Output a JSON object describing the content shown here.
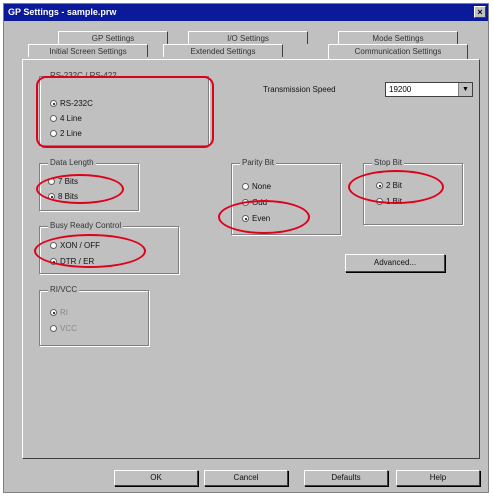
{
  "window": {
    "title": "GP Settings - sample.prw",
    "close_label": "×"
  },
  "tabs_top": [
    "GP Settings",
    "I/O Settings",
    "Mode Settings"
  ],
  "tabs_bottom": [
    "Initial Screen Settings",
    "Extended Settings",
    "Communication Settings"
  ],
  "rs": {
    "title": "RS-232C / RS-422",
    "options": [
      "RS-232C",
      "4 Line",
      "2 Line"
    ],
    "selected": "RS-232C"
  },
  "transmission": {
    "label": "Transmission Speed",
    "value": "19200"
  },
  "data_length": {
    "title": "Data Length",
    "options": [
      "7 Bits",
      "8 Bits"
    ],
    "selected": "8 Bits"
  },
  "parity": {
    "title": "Parity Bit",
    "options": [
      "None",
      "Odd",
      "Even"
    ],
    "selected": "Even"
  },
  "stop_bit": {
    "title": "Stop Bit",
    "options": [
      "2 Bit",
      "1 Bit"
    ],
    "selected": "2 Bit"
  },
  "busy": {
    "title": "Busy Ready Control",
    "options": [
      "XON / OFF",
      "DTR / ER"
    ],
    "selected": "DTR / ER"
  },
  "ricc": {
    "title": "RI/VCC",
    "options": [
      "RI",
      "VCC"
    ],
    "selected": "RI"
  },
  "advanced_label": "Advanced...",
  "footer": {
    "ok": "OK",
    "cancel": "Cancel",
    "defaults": "Defaults",
    "help": "Help"
  },
  "colors": {
    "titlebar": "#0b1a9a",
    "dialog": "#c0c0c0",
    "highlight": "#e0001a"
  }
}
